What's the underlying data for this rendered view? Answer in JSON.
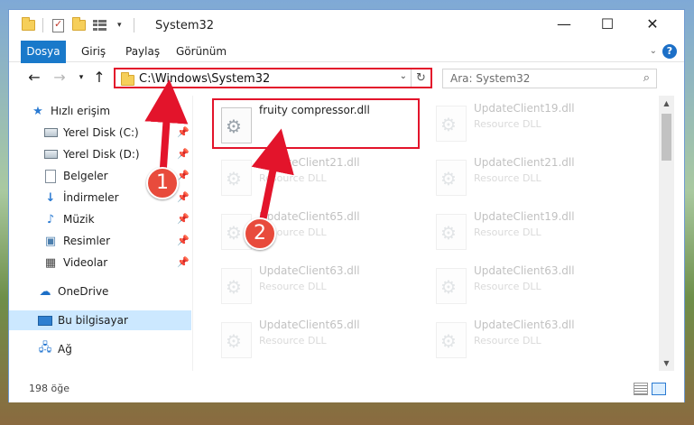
{
  "window": {
    "title": "System32",
    "minimize": "—",
    "maximize": "☐",
    "close": "✕"
  },
  "ribbon": {
    "tabs": [
      "Dosya",
      "Giriş",
      "Paylaş",
      "Görünüm"
    ],
    "help": "?"
  },
  "address": {
    "path": "C:\\Windows\\System32",
    "search_placeholder": "Ara: System32"
  },
  "sidebar": {
    "quick_access": "Hızlı erişim",
    "items": [
      {
        "label": "Yerel Disk (C:)",
        "icon": "drive-icon",
        "pinned": true
      },
      {
        "label": "Yerel Disk (D:)",
        "icon": "drive-icon",
        "pinned": true
      },
      {
        "label": "Belgeler",
        "icon": "documents-icon",
        "pinned": true
      },
      {
        "label": "İndirmeler",
        "icon": "downloads-icon",
        "pinned": true
      },
      {
        "label": "Müzik",
        "icon": "music-icon",
        "pinned": true
      },
      {
        "label": "Resimler",
        "icon": "pictures-icon",
        "pinned": true
      },
      {
        "label": "Videolar",
        "icon": "videos-icon",
        "pinned": true
      }
    ],
    "onedrive": "OneDrive",
    "this_pc": "Bu bilgisayar",
    "network": "Ağ"
  },
  "files": [
    {
      "name": "fruity compressor.dll",
      "type": "",
      "faded": false,
      "highlight": true
    },
    {
      "name": "UpdateClient19.dll",
      "type": "Resource DLL",
      "faded": true
    },
    {
      "name": "UpdateClient21.dll",
      "type": "Resource DLL",
      "faded": true
    },
    {
      "name": "UpdateClient21.dll",
      "type": "Resource DLL",
      "faded": true
    },
    {
      "name": "UpdateClient65.dll",
      "type": "Resource DLL",
      "faded": true
    },
    {
      "name": "UpdateClient19.dll",
      "type": "Resource DLL",
      "faded": true
    },
    {
      "name": "UpdateClient63.dll",
      "type": "Resource DLL",
      "faded": true
    },
    {
      "name": "UpdateClient63.dll",
      "type": "Resource DLL",
      "faded": true
    },
    {
      "name": "UpdateClient65.dll",
      "type": "Resource DLL",
      "faded": true
    },
    {
      "name": "UpdateClient63.dll",
      "type": "Resource DLL",
      "faded": true
    }
  ],
  "status": {
    "item_count": "198 öğe"
  },
  "annotations": {
    "step1": "1",
    "step2": "2",
    "color": "#e3142b"
  }
}
